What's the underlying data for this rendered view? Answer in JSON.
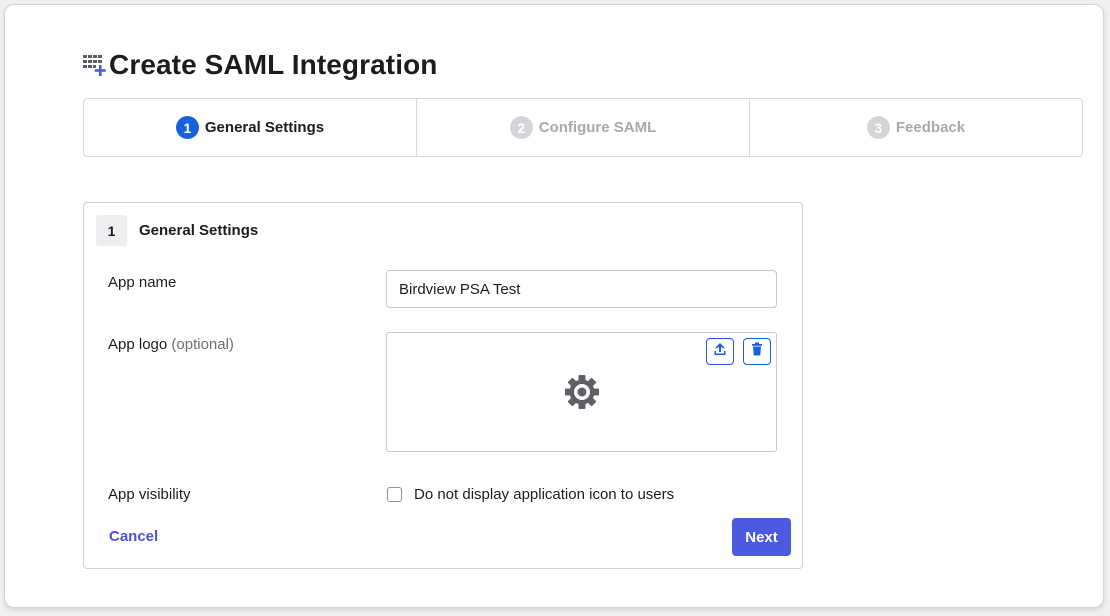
{
  "page": {
    "title": "Create SAML Integration"
  },
  "stepper": {
    "steps": [
      {
        "number": "1",
        "label": "General Settings",
        "state": "active"
      },
      {
        "number": "2",
        "label": "Configure SAML",
        "state": "inactive"
      },
      {
        "number": "3",
        "label": "Feedback",
        "state": "inactive"
      }
    ]
  },
  "panel": {
    "number": "1",
    "title": "General Settings",
    "app_name": {
      "label": "App name",
      "value": "Birdview PSA Test"
    },
    "app_logo": {
      "label": "App logo",
      "optional": "(optional)",
      "icons": [
        "upload-icon",
        "trash-icon",
        "gear-icon"
      ]
    },
    "app_visibility": {
      "label": "App visibility",
      "checkbox_label": "Do not display application icon to users",
      "checked": false
    },
    "cancel_label": "Cancel",
    "next_label": "Next"
  },
  "colors": {
    "primary": "#1662dd",
    "button": "#4b5ae0",
    "link": "#4a55cc",
    "inactive": "#d5d5d9"
  }
}
